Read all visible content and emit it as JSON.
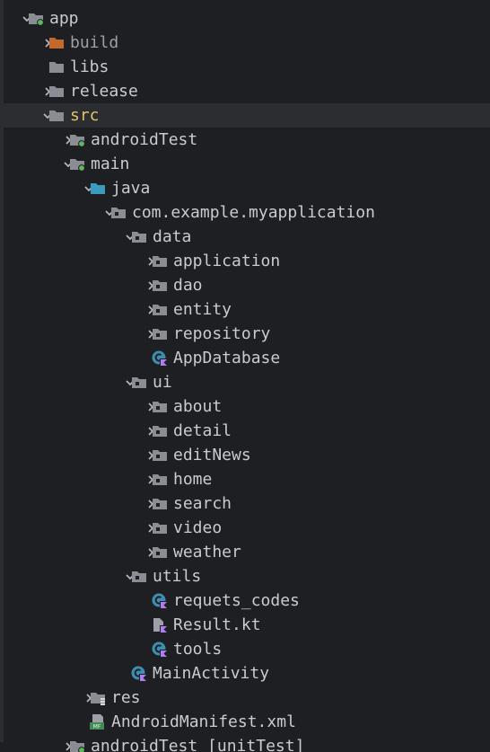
{
  "colors": {
    "background": "#1e1f22",
    "selected_row": "#2b2d30",
    "text": "#c9cbd0",
    "excluded_text": "#9da0a8",
    "src_text": "#e0c46c",
    "folder": "#8a8d93",
    "build_folder": "#c3692e",
    "java_folder": "#3a9bbd",
    "module_badge": "#5fb85f",
    "kotlin_class": "#3d8fb2",
    "kotlin_badge": "#b07cf0"
  },
  "tree": [
    {
      "label": "app",
      "depth": 0,
      "arrow": "down",
      "icon": "module-folder-icon",
      "style": "normal"
    },
    {
      "label": "build",
      "depth": 1,
      "arrow": "right",
      "icon": "excluded-folder-icon",
      "style": "dim"
    },
    {
      "label": "libs",
      "depth": 1,
      "arrow": "none",
      "icon": "folder-icon",
      "style": "normal"
    },
    {
      "label": "release",
      "depth": 1,
      "arrow": "right",
      "icon": "folder-icon",
      "style": "normal"
    },
    {
      "label": "src",
      "depth": 1,
      "arrow": "down",
      "icon": "folder-icon",
      "style": "yellow",
      "selected": true
    },
    {
      "label": "androidTest",
      "depth": 2,
      "arrow": "right",
      "icon": "module-folder-icon",
      "style": "normal"
    },
    {
      "label": "main",
      "depth": 2,
      "arrow": "down",
      "icon": "module-folder-icon",
      "style": "normal"
    },
    {
      "label": "java",
      "depth": 3,
      "arrow": "down",
      "icon": "source-folder-icon",
      "style": "normal"
    },
    {
      "label": "com.example.myapplication",
      "depth": 4,
      "arrow": "down",
      "icon": "package-icon",
      "style": "normal"
    },
    {
      "label": "data",
      "depth": 5,
      "arrow": "down",
      "icon": "package-icon",
      "style": "normal"
    },
    {
      "label": "application",
      "depth": 6,
      "arrow": "right",
      "icon": "package-icon",
      "style": "normal"
    },
    {
      "label": "dao",
      "depth": 6,
      "arrow": "right",
      "icon": "package-icon",
      "style": "normal"
    },
    {
      "label": "entity",
      "depth": 6,
      "arrow": "right",
      "icon": "package-icon",
      "style": "normal"
    },
    {
      "label": "repository",
      "depth": 6,
      "arrow": "right",
      "icon": "package-icon",
      "style": "normal"
    },
    {
      "label": "AppDatabase",
      "depth": 6,
      "arrow": "none",
      "icon": "kotlin-class-icon",
      "style": "normal"
    },
    {
      "label": "ui",
      "depth": 5,
      "arrow": "down",
      "icon": "package-icon",
      "style": "normal"
    },
    {
      "label": "about",
      "depth": 6,
      "arrow": "right",
      "icon": "package-icon",
      "style": "normal"
    },
    {
      "label": "detail",
      "depth": 6,
      "arrow": "right",
      "icon": "package-icon",
      "style": "normal"
    },
    {
      "label": "editNews",
      "depth": 6,
      "arrow": "right",
      "icon": "package-icon",
      "style": "normal"
    },
    {
      "label": "home",
      "depth": 6,
      "arrow": "right",
      "icon": "package-icon",
      "style": "normal"
    },
    {
      "label": "search",
      "depth": 6,
      "arrow": "right",
      "icon": "package-icon",
      "style": "normal"
    },
    {
      "label": "video",
      "depth": 6,
      "arrow": "right",
      "icon": "package-icon",
      "style": "normal"
    },
    {
      "label": "weather",
      "depth": 6,
      "arrow": "right",
      "icon": "package-icon",
      "style": "normal"
    },
    {
      "label": "utils",
      "depth": 5,
      "arrow": "down",
      "icon": "package-icon",
      "style": "normal"
    },
    {
      "label": "requets_codes",
      "depth": 6,
      "arrow": "none",
      "icon": "kotlin-class-icon",
      "style": "normal"
    },
    {
      "label": "Result.kt",
      "depth": 6,
      "arrow": "none",
      "icon": "kotlin-file-icon",
      "style": "normal"
    },
    {
      "label": "tools",
      "depth": 6,
      "arrow": "none",
      "icon": "kotlin-class-icon",
      "style": "normal"
    },
    {
      "label": "MainActivity",
      "depth": 5,
      "arrow": "none",
      "icon": "kotlin-class-icon",
      "style": "normal"
    },
    {
      "label": "res",
      "depth": 3,
      "arrow": "right",
      "icon": "resources-folder-icon",
      "style": "normal"
    },
    {
      "label": "AndroidManifest.xml",
      "depth": 3,
      "arrow": "none",
      "icon": "manifest-icon",
      "style": "normal"
    },
    {
      "label": "androidTest [unitTest]",
      "depth": 2,
      "arrow": "right",
      "icon": "module-folder-icon",
      "style": "normal",
      "partial": true
    }
  ]
}
